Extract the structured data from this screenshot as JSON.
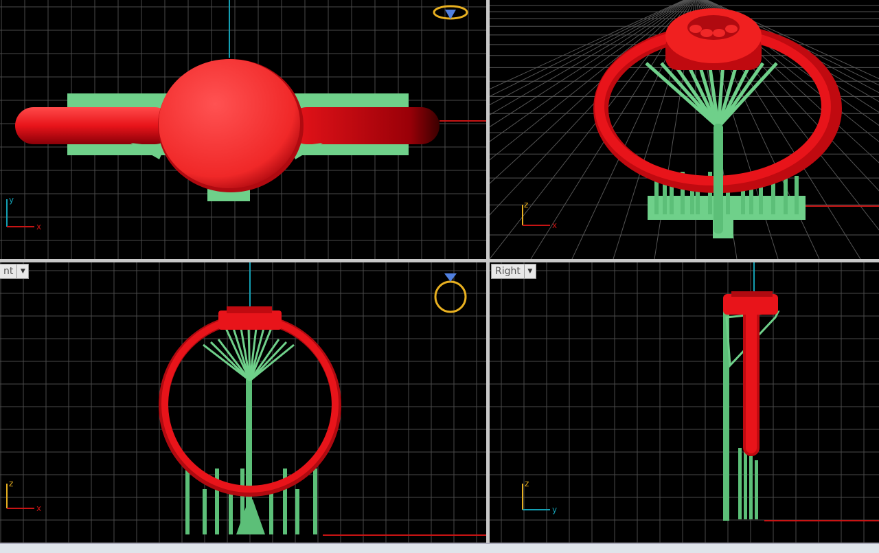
{
  "viewports": {
    "top": {
      "axis_x": "x",
      "axis_y": "y"
    },
    "perspective": {
      "axis_x": "x",
      "axis_z": "z"
    },
    "front": {
      "tab_label": "nt",
      "axis_x": "x",
      "axis_z": "z"
    },
    "right": {
      "tab_label": "Right",
      "axis_y": "y",
      "axis_z": "z"
    }
  },
  "colors": {
    "background": "#000000",
    "grid": "#4a4a4a",
    "ring": "#e8141a",
    "supports": "#6fd08a",
    "axis_x": "#c81414",
    "axis_y": "#14a0b4",
    "gumball_icon": "#e8b020"
  },
  "icons": [
    "gumball-ring-icon",
    "dropdown-arrow-icon",
    "axis-widget-icon"
  ]
}
